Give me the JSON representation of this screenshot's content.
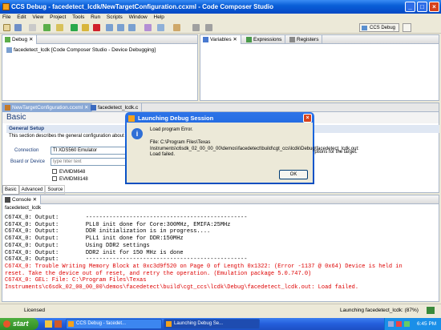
{
  "window": {
    "title": "CCS Debug - facedetect_lcdk/NewTargetConfiguration.ccxml - Code Composer Studio"
  },
  "menu": [
    "File",
    "Edit",
    "View",
    "Project",
    "Tools",
    "Run",
    "Scripts",
    "Window",
    "Help"
  ],
  "perspective": {
    "label": "CCS Debug"
  },
  "debug_view": {
    "tab": "Debug",
    "tree_item": "facedetect_lcdk [Code Composer Studio - Device Debugging]"
  },
  "right_tabs": [
    "Variables",
    "Expressions",
    "Registers"
  ],
  "editor_tabs": [
    "NewTargetConfiguration.ccxml",
    "facedetect_lcdk.c"
  ],
  "config": {
    "heading": "Basic",
    "section": "General Setup",
    "section_desc": "This section describes the general configuration about",
    "connection_label": "Connection",
    "connection_value": "TI XDS560 Emulator",
    "board_label": "Board or Device",
    "filter_placeholder": "type filter text",
    "devices": [
      "EVMDM648",
      "EVMDM8148"
    ],
    "right_note": "options for the target.",
    "bottom_tabs": [
      "Basic",
      "Advanced",
      "Source"
    ]
  },
  "console": {
    "tab": "Console",
    "subtitle": "facedetect_lcdk",
    "lines": [
      {
        "text": "C674X_0: Output:        ------------------------------------------------",
        "color": "#000000"
      },
      {
        "text": "C674X_0: Output:        PLL0 init done for Core:300MHz, EMIFA:25MHz",
        "color": "#000000"
      },
      {
        "text": "C674X_0: Output:        DDR initialization is in progress....",
        "color": "#000000"
      },
      {
        "text": "C674X_0: Output:        PLL1 init done for DDR:150MHz",
        "color": "#000000"
      },
      {
        "text": "C674X_0: Output:        Using DDR2 settings",
        "color": "#000000"
      },
      {
        "text": "C674X_0: Output:        DDR2 init for 150 MHz is done",
        "color": "#000000"
      },
      {
        "text": "C674X_0: Output:        ------------------------------------------------",
        "color": "#000000"
      },
      {
        "text": "C674X_0: Trouble Writing Memory Block at 0xc3d9f520 on Page 0 of Length 0x1322: (Error -1137 @ 0x64) Device is held in",
        "color": "#dd0000"
      },
      {
        "text": "reset. Take the device out of reset, and retry the operation. (Emulation package 5.0.747.0)",
        "color": "#dd0000"
      },
      {
        "text": "C674X_0: GEL: File: C:\\Program Files\\Texas",
        "color": "#dd0000"
      },
      {
        "text": "Instruments\\c6sdk_02_00_00_00\\demos\\facedetect\\build\\cgt_ccs\\lcdk\\Debug\\facedetect_lcdk.out: Load failed.",
        "color": "#dd0000"
      }
    ]
  },
  "dialog": {
    "title": "Launching Debug Session",
    "message_title": "Load program Error.",
    "message_body": "File: C:\\Program Files\\Texas Instruments\\c6sdk_02_00_00_00\\demos\\facedetect\\build\\cgt_ccs\\lcdk\\Debug\\facedetect_lcdk.out: Load failed.",
    "ok": "OK"
  },
  "statusbar": {
    "left": "Licensed",
    "right": "Launching facedetect_lcdk: (87%)"
  },
  "taskbar": {
    "start": "start",
    "items": [
      "CCS Debug - facedet...",
      "Launching Debug Se..."
    ],
    "clock": "6:45 PM"
  },
  "colors": {
    "accent": "#245edb",
    "error_text": "#dd0000",
    "window_bg": "#ece9d8"
  }
}
